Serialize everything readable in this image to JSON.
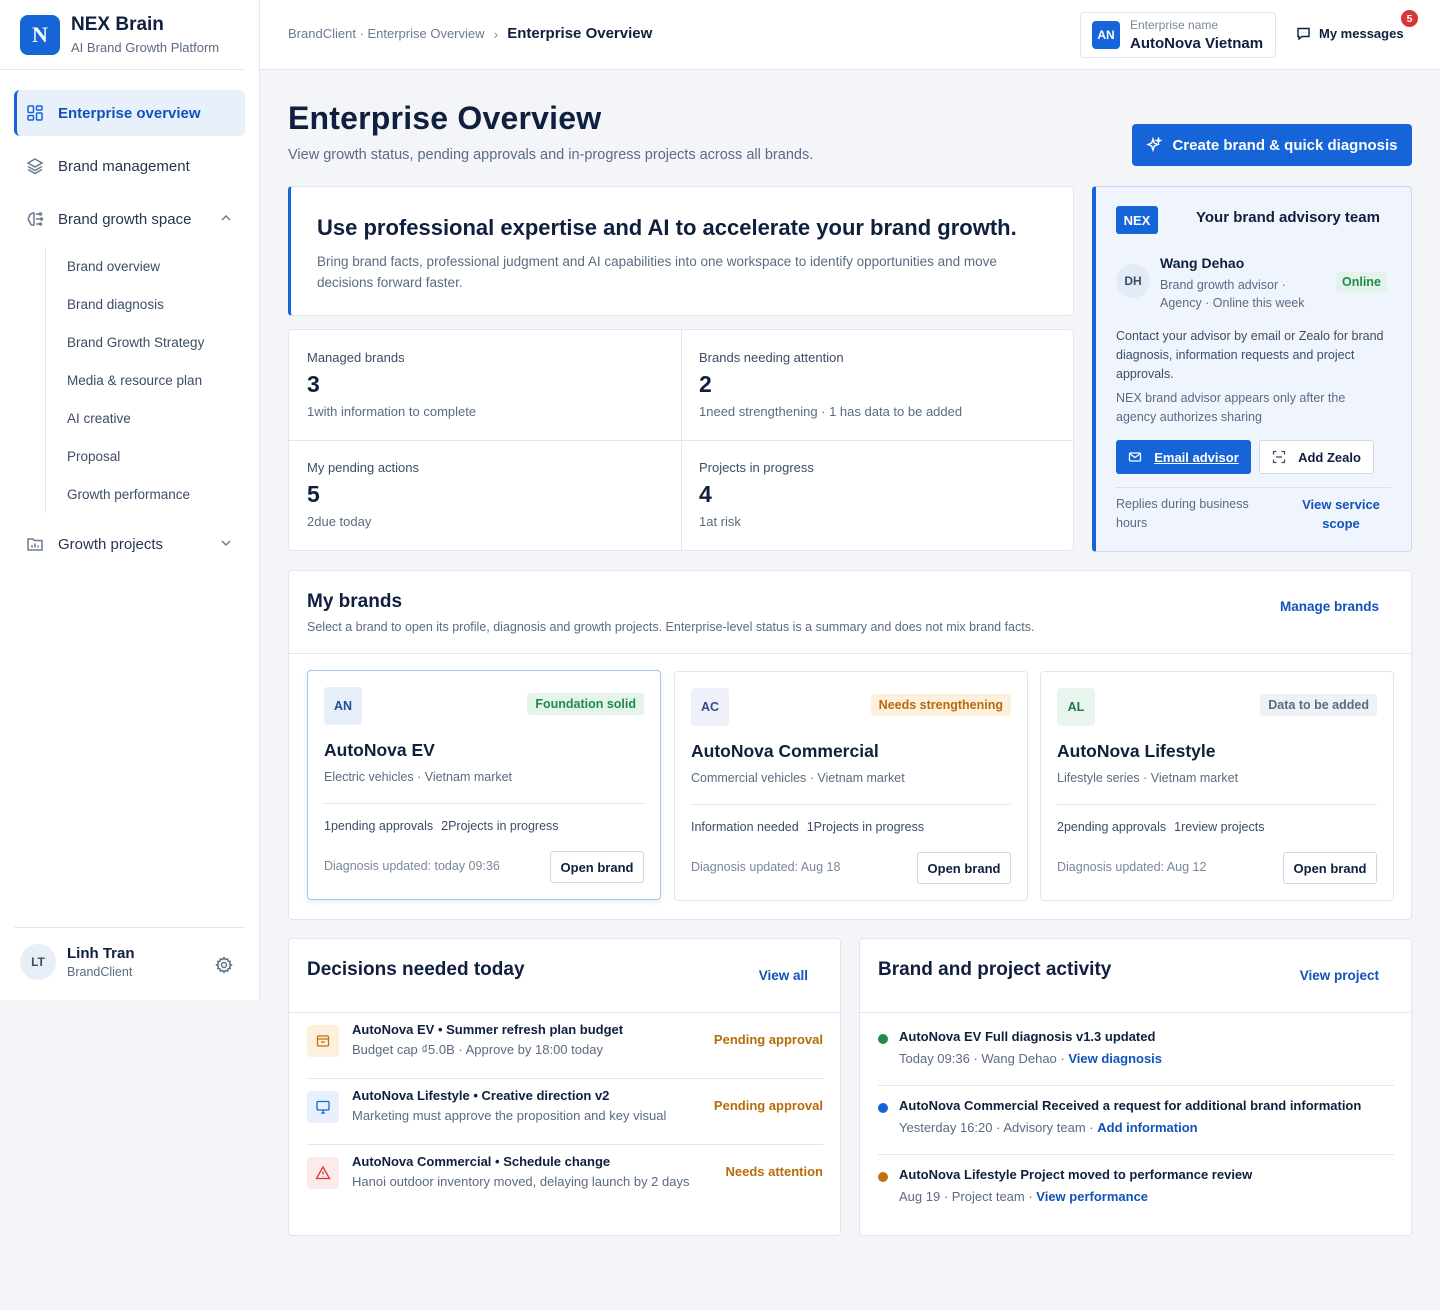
{
  "app": {
    "name": "NEX Brain",
    "subtitle": "AI Brand Growth Platform",
    "logo_letter": "N"
  },
  "sidebar": {
    "items": [
      {
        "label": "Enterprise overview",
        "icon": "grid-icon",
        "active": true
      },
      {
        "label": "Brand management",
        "icon": "layers-icon"
      },
      {
        "label": "Brand growth space",
        "icon": "brain-icon",
        "expanded": true
      },
      {
        "label": "Growth projects",
        "icon": "folder-chart-icon",
        "expanded": false
      }
    ],
    "sub_items": [
      "Brand overview",
      "Brand diagnosis",
      "Brand Growth Strategy",
      "Media & resource plan",
      "AI creative",
      "Proposal",
      "Growth performance"
    ],
    "user": {
      "initials": "LT",
      "name": "Linh Tran",
      "role": "BrandClient"
    }
  },
  "topbar": {
    "breadcrumb_root": "BrandClient · Enterprise Overview",
    "breadcrumb_current": "Enterprise Overview",
    "enterprise_label": "Enterprise name",
    "enterprise_initials": "AN",
    "enterprise_value": "AutoNova Vietnam",
    "messages_label": "My messages",
    "messages_count": "5"
  },
  "page": {
    "title": "Enterprise Overview",
    "subtitle": "View growth status, pending approvals and in-progress projects across all brands.",
    "cta": "Create brand & quick diagnosis"
  },
  "hero": {
    "title": "Use professional expertise and AI to accelerate your brand growth.",
    "text": "Bring brand facts, professional judgment and AI capabilities into one workspace to identify opportunities and move decisions forward faster."
  },
  "stats": [
    {
      "label": "Managed brands",
      "value": "3",
      "note": "1with information to complete"
    },
    {
      "label": "Brands needing attention",
      "value": "2",
      "note": "1need strengthening · 1 has data to be added"
    },
    {
      "label": "My pending actions",
      "value": "5",
      "note": "2due today"
    },
    {
      "label": "Projects in progress",
      "value": "4",
      "note": "1at risk"
    }
  ],
  "advisor": {
    "tag": "NEX",
    "title": "Your brand advisory team",
    "initials": "DH",
    "name": "Wang Dehao",
    "role": "Brand growth advisor · Agency · Online this week",
    "status": "Online",
    "text": "Contact your advisor by email or Zealo for brand diagnosis, information requests and project approvals.",
    "note": "NEX brand advisor appears only after the agency authorizes sharing",
    "email_btn": "Email advisor",
    "zealo_btn": "Add Zealo",
    "hours": "Replies during business hours",
    "scope_link": "View service scope"
  },
  "brands": {
    "title": "My brands",
    "subtitle": "Select a brand to open its profile, diagnosis and growth projects. Enterprise-level status is a summary and does not mix brand facts.",
    "manage_link": "Manage brands",
    "open_label": "Open brand",
    "cards": [
      {
        "initials": "AN",
        "status": "Foundation solid",
        "name": "AutoNova EV",
        "desc": "Electric vehicles · Vietnam market",
        "stat1": "1pending approvals",
        "stat2": "2Projects in progress",
        "updated": "Diagnosis updated: today 09:36"
      },
      {
        "initials": "AC",
        "status": "Needs strengthening",
        "name": "AutoNova Commercial",
        "desc": "Commercial vehicles · Vietnam market",
        "stat1": "Information needed",
        "stat2": "1Projects in progress",
        "updated": "Diagnosis updated: Aug 18"
      },
      {
        "initials": "AL",
        "status": "Data to be added",
        "name": "AutoNova Lifestyle",
        "desc": "Lifestyle series · Vietnam market",
        "stat1": "2pending approvals",
        "stat2": "1review projects",
        "updated": "Diagnosis updated: Aug 12"
      }
    ]
  },
  "decisions": {
    "title": "Decisions needed today",
    "link": "View all",
    "items": [
      {
        "title": "AutoNova EV • Summer refresh plan budget",
        "sub": "Budget cap ₫5.0B · Approve by 18:00 today",
        "status": "Pending approval",
        "icon": "budget-icon"
      },
      {
        "title": "AutoNova Lifestyle • Creative direction v2",
        "sub": "Marketing must approve the proposition and key visual",
        "status": "Pending approval",
        "icon": "monitor-icon"
      },
      {
        "title": "AutoNova Commercial • Schedule change",
        "sub": "Hanoi outdoor inventory moved, delaying launch by 2 days",
        "status": "Needs attention",
        "icon": "warning-icon"
      }
    ]
  },
  "activity": {
    "title": "Brand and project activity",
    "link": "View project",
    "items": [
      {
        "title": "AutoNova EV Full diagnosis v1.3 updated",
        "meta": "Today 09:36 · Wang Dehao · ",
        "action": "View diagnosis",
        "color": "#1f8a4c"
      },
      {
        "title": "AutoNova Commercial Received a request for additional brand information",
        "meta": "Yesterday 16:20 · Advisory team · ",
        "action": "Add information",
        "color": "#1565d8"
      },
      {
        "title": "AutoNova Lifestyle Project moved to performance review",
        "meta": "Aug 19 · Project team · ",
        "action": "View performance",
        "color": "#c2710c"
      }
    ]
  }
}
